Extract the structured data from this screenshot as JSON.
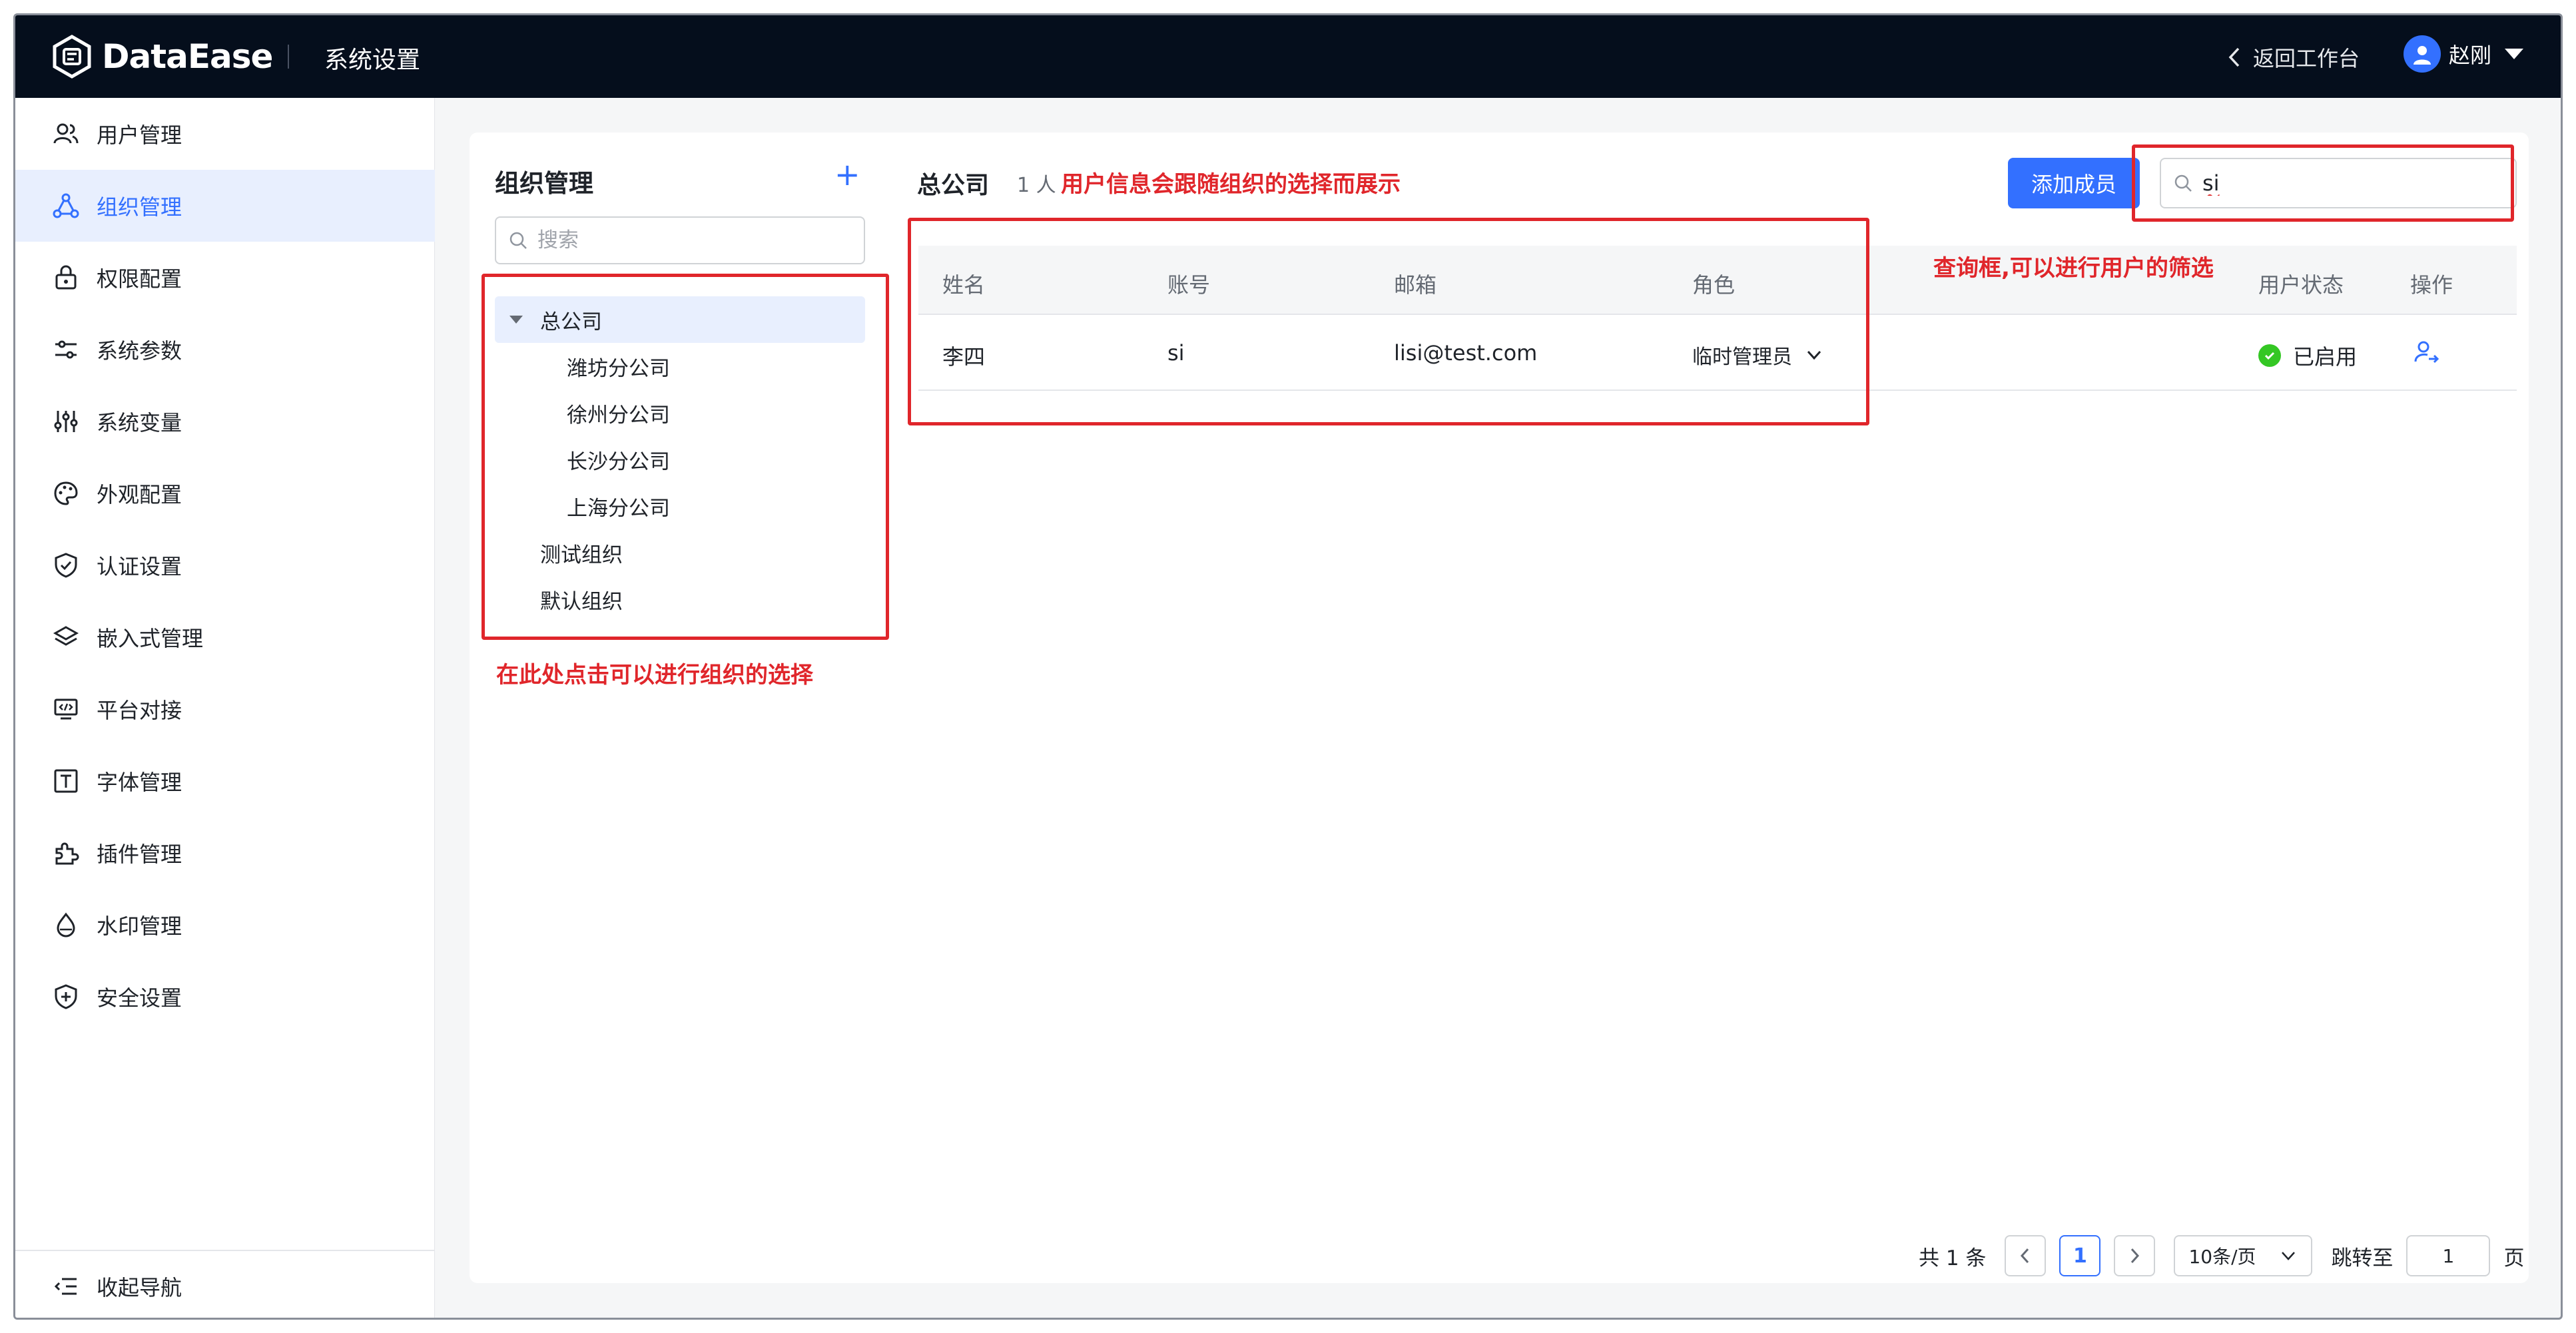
{
  "topbar": {
    "brand": "DataEase",
    "section_title": "系统设置",
    "back_label": "返回工作台",
    "user_name": "赵刚"
  },
  "sidebar": {
    "items": [
      {
        "label": "用户管理",
        "icon": "users-icon"
      },
      {
        "label": "组织管理",
        "icon": "org-icon",
        "active": true
      },
      {
        "label": "权限配置",
        "icon": "lock-icon"
      },
      {
        "label": "系统参数",
        "icon": "sliders-icon"
      },
      {
        "label": "系统变量",
        "icon": "variables-icon"
      },
      {
        "label": "外观配置",
        "icon": "palette-icon"
      },
      {
        "label": "认证设置",
        "icon": "shield-check-icon"
      },
      {
        "label": "嵌入式管理",
        "icon": "layers-icon"
      },
      {
        "label": "平台对接",
        "icon": "monitor-code-icon"
      },
      {
        "label": "字体管理",
        "icon": "font-icon"
      },
      {
        "label": "插件管理",
        "icon": "plugin-icon"
      },
      {
        "label": "水印管理",
        "icon": "drop-icon"
      },
      {
        "label": "安全设置",
        "icon": "shield-plus-icon"
      }
    ],
    "collapse_label": "收起导航"
  },
  "org": {
    "title": "组织管理",
    "add_symbol": "+",
    "search_placeholder": "搜索",
    "tree": [
      {
        "label": "总公司",
        "level": 0,
        "expanded": true,
        "selected": true
      },
      {
        "label": "潍坊分公司",
        "level": 1
      },
      {
        "label": "徐州分公司",
        "level": 1
      },
      {
        "label": "长沙分公司",
        "level": 1
      },
      {
        "label": "上海分公司",
        "level": 1
      },
      {
        "label": "测试组织",
        "level": 0
      },
      {
        "label": "默认组织",
        "level": 0
      }
    ]
  },
  "members": {
    "company": "总公司",
    "count": "1 人",
    "add_button": "添加成员",
    "search_value": "si",
    "columns": [
      "姓名",
      "账号",
      "邮箱",
      "角色",
      "用户状态",
      "操作"
    ],
    "rows": [
      {
        "name": "李四",
        "account": "si",
        "email": "lisi@test.com",
        "role": "临时管理员",
        "status": "已启用"
      }
    ]
  },
  "pagination": {
    "total": "共 1 条",
    "current_page": "1",
    "page_size": "10条/页",
    "jump_label": "跳转至",
    "jump_value": "1",
    "page_suffix": "页"
  },
  "annotations": {
    "members_note": "用户信息会跟随组织的选择而展示",
    "search_note": "查询框,可以进行用户的筛选",
    "tree_note": "在此处点击可以进行组织的选择"
  },
  "colors": {
    "accent": "#3370ff",
    "topbar_bg": "#050e1c",
    "annotation": "#e0262b",
    "status_ok": "#34c724"
  }
}
